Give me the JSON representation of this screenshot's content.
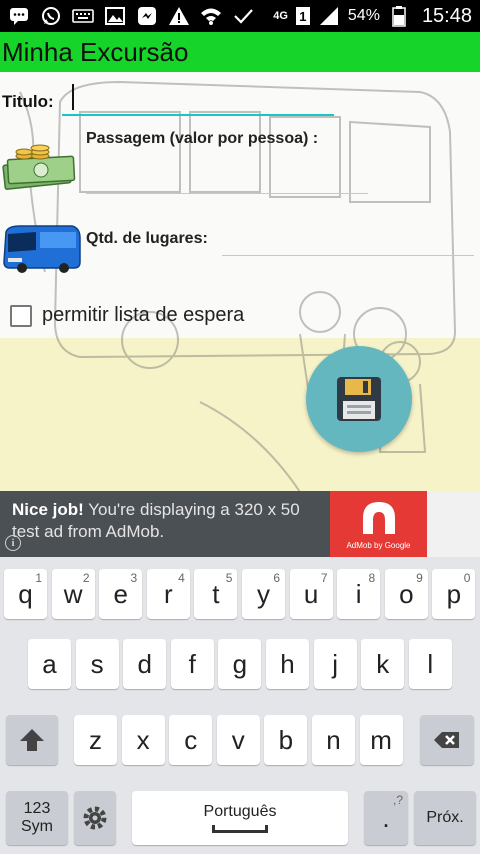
{
  "status_bar": {
    "network": "4G",
    "sim": "1",
    "battery": "54%",
    "time": "15:48",
    "icons": [
      "chat-icon",
      "whatsapp-icon",
      "keyboard-icon",
      "image-icon",
      "messenger-icon",
      "warning-icon",
      "wifi-icon",
      "check-icon",
      "signal-icon",
      "battery-icon"
    ]
  },
  "app_bar": {
    "title": "Minha Excursão"
  },
  "form": {
    "title_label": "Titulo:",
    "title_value": "",
    "passagem_label": "Passagem (valor por pessoa) :",
    "passagem_value": "",
    "qtd_label": "Qtd. de lugares:",
    "qtd_value": "",
    "waitlist_label": "permitir lista de espera",
    "waitlist_checked": false,
    "save_icon": "floppy-disk-icon"
  },
  "ad": {
    "bold": "Nice job!",
    "text": " You're displaying a 320 x 50 test ad from AdMob.",
    "logo_text": "AdMob by Google",
    "info": "i"
  },
  "keyboard": {
    "row1": [
      {
        "key": "q",
        "hint": "1"
      },
      {
        "key": "w",
        "hint": "2"
      },
      {
        "key": "e",
        "hint": "3"
      },
      {
        "key": "r",
        "hint": "4"
      },
      {
        "key": "t",
        "hint": "5"
      },
      {
        "key": "y",
        "hint": "6"
      },
      {
        "key": "u",
        "hint": "7"
      },
      {
        "key": "i",
        "hint": "8"
      },
      {
        "key": "o",
        "hint": "9"
      },
      {
        "key": "p",
        "hint": "0"
      }
    ],
    "row2": [
      "a",
      "s",
      "d",
      "f",
      "g",
      "h",
      "j",
      "k",
      "l"
    ],
    "row3": [
      "z",
      "x",
      "c",
      "v",
      "b",
      "n",
      "m"
    ],
    "sym_label_1": "123",
    "sym_label_2": "Sym",
    "space_label": "Português",
    "period": ".",
    "period_hint": ",?",
    "next_label": "Próx.",
    "accent": "#64b7bf",
    "appbar_color": "#16d42a"
  }
}
